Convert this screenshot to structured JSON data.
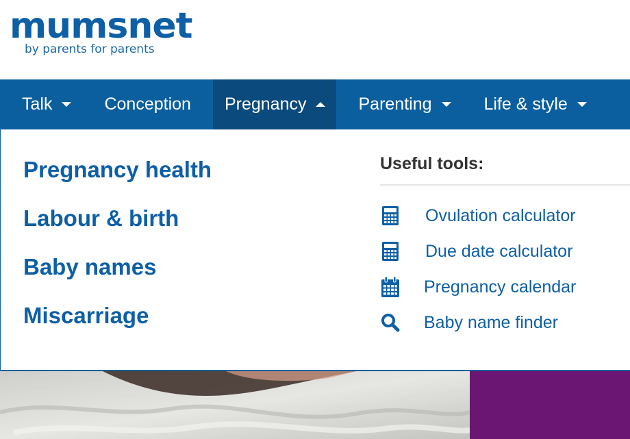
{
  "brand": {
    "name": "mumsnet",
    "tagline": "by parents for parents",
    "color": "#0d5fa6"
  },
  "nav": {
    "background": "#0b5f9e",
    "items": [
      {
        "label": "Talk",
        "has_caret": true,
        "expanded": false
      },
      {
        "label": "Conception",
        "has_caret": false,
        "expanded": false
      },
      {
        "label": "Pregnancy",
        "has_caret": true,
        "expanded": true
      },
      {
        "label": "Parenting",
        "has_caret": true,
        "expanded": false
      },
      {
        "label": "Life & style",
        "has_caret": true,
        "expanded": false
      }
    ]
  },
  "dropdown": {
    "links": [
      {
        "label": "Pregnancy health"
      },
      {
        "label": "Labour & birth"
      },
      {
        "label": "Baby names"
      },
      {
        "label": "Miscarriage"
      }
    ],
    "tools_title": "Useful tools:",
    "tools": [
      {
        "label": "Ovulation calculator",
        "icon": "calculator-icon"
      },
      {
        "label": "Due date calculator",
        "icon": "calculator-icon"
      },
      {
        "label": "Pregnancy calendar",
        "icon": "calendar-icon"
      },
      {
        "label": "Baby name finder",
        "icon": "search-icon"
      }
    ]
  },
  "hero": {
    "side_color": "#6a1672"
  }
}
